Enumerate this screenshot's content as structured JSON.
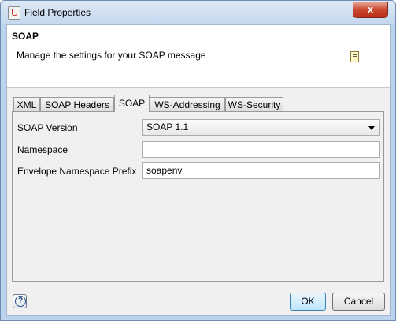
{
  "window": {
    "title": "Field Properties",
    "close_glyph": "x"
  },
  "header": {
    "title": "SOAP",
    "description": "Manage the settings for your SOAP message"
  },
  "tabs": [
    {
      "label": "XML",
      "active": false
    },
    {
      "label": "SOAP Headers",
      "active": false
    },
    {
      "label": "SOAP",
      "active": true
    },
    {
      "label": "WS-Addressing",
      "active": false
    },
    {
      "label": "WS-Security",
      "active": false
    }
  ],
  "form": {
    "soap_version": {
      "label": "SOAP Version",
      "value": "SOAP 1.1"
    },
    "namespace": {
      "label": "Namespace",
      "value": ""
    },
    "envelope_prefix": {
      "label": "Envelope Namespace Prefix",
      "value": "soapenv"
    }
  },
  "footer": {
    "help_glyph": "?",
    "ok_label": "OK",
    "cancel_label": "Cancel"
  }
}
